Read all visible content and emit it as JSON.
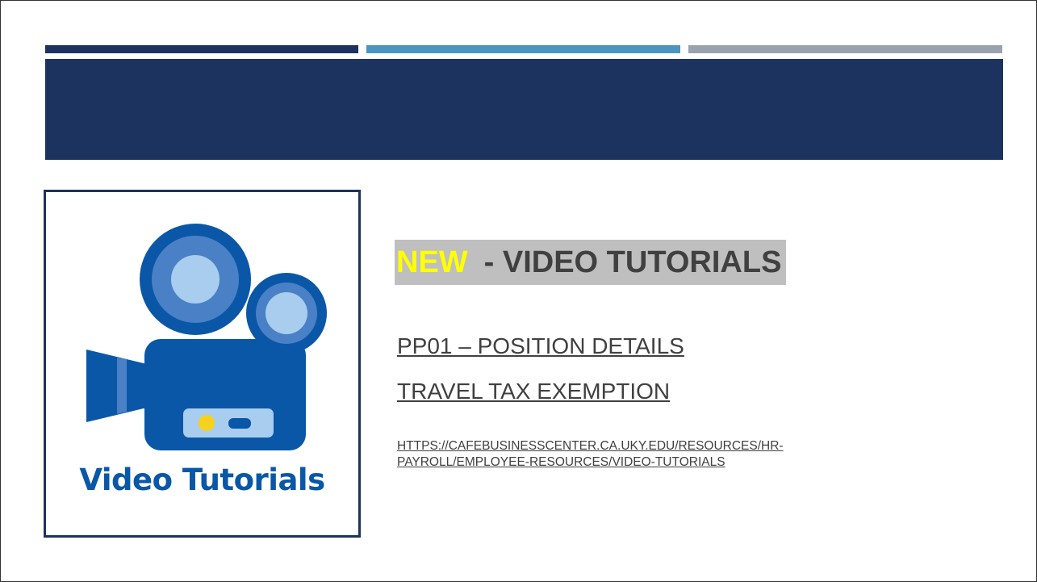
{
  "colors": {
    "navy": "#1c335f",
    "accent_blue": "#4a95c2",
    "accent_gray": "#9aa3ad",
    "highlight_bg": "#bfbfbf",
    "highlight_yellow": "#ffff00",
    "text_gray": "#404040",
    "camera_blue": "#0a57a8",
    "camera_mid": "#4a80c6",
    "camera_light": "#a9cdee",
    "dot_yellow": "#f7d21c"
  },
  "image": {
    "icon": "video-camera-icon",
    "caption": "Video Tutorials"
  },
  "headline": {
    "new_label": "NEW",
    "title": "- VIDEO TUTORIALS"
  },
  "links": [
    "PP01 – POSITION DETAILS",
    "TRAVEL TAX EXEMPTION"
  ],
  "url": {
    "line1": "HTTPS://CAFEBUSINESSCENTER.CA.UKY.EDU/RESOURCES/HR-",
    "line2": "PAYROLL/EMPLOYEE-RESOURCES/VIDEO-TUTORIALS"
  }
}
